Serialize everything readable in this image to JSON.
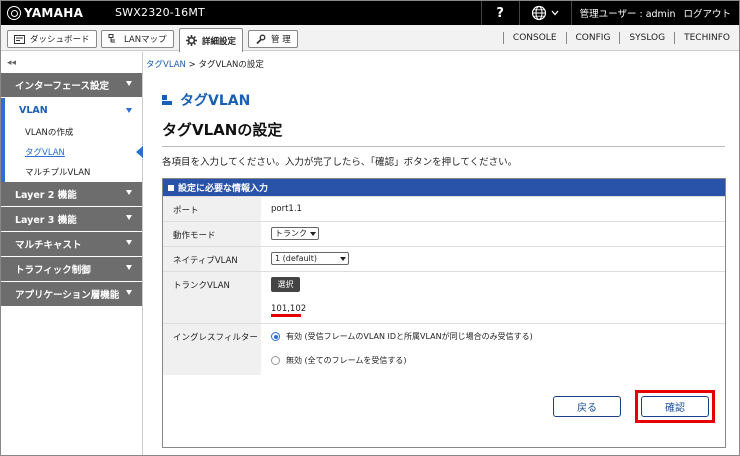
{
  "header": {
    "brand": "YAMAHA",
    "model": "SWX2320-16MT",
    "help": "?",
    "user_label": "管理ユーザー : admin",
    "logout": "ログアウト"
  },
  "nav": {
    "dashboard": "ダッシュボード",
    "lanmap": "LANマップ",
    "detail": "詳細設定",
    "manage": "管 理",
    "links": [
      "CONSOLE",
      "CONFIG",
      "SYSLOG",
      "TECHINFO"
    ]
  },
  "sidebar": {
    "collapse": "◂◂",
    "categories_top": [
      {
        "label": "インターフェース設定"
      }
    ],
    "open_category": "VLAN",
    "subitems": [
      {
        "label": "VLANの作成"
      },
      {
        "label": "タグVLAN"
      },
      {
        "label": "マルチプルVLAN"
      }
    ],
    "categories_bottom": [
      {
        "label": "Layer 2 機能"
      },
      {
        "label": "Layer 3 機能"
      },
      {
        "label": "マルチキャスト"
      },
      {
        "label": "トラフィック制御"
      },
      {
        "label": "アプリケーション層機能"
      }
    ]
  },
  "breadcrumb": {
    "link": "タグVLAN",
    "sep": " > ",
    "current": "タグVLANの設定"
  },
  "main": {
    "section_title": "タグVLAN",
    "page_title": "タグVLANの設定",
    "instruction": "各項目を入力してください。入力が完了したら、「確認」ボタンを押してください。"
  },
  "panel": {
    "title": "設定に必要な情報入力",
    "rows": {
      "port": {
        "label": "ポート",
        "value": "port1.1"
      },
      "mode": {
        "label": "動作モード",
        "value": "トランク"
      },
      "native": {
        "label": "ネイティブVLAN",
        "value": "1 (default)"
      },
      "trunk": {
        "label": "トランクVLAN",
        "button": "選択",
        "value": "101,102"
      },
      "ingress": {
        "label": "イングレスフィルター",
        "option_on": "有効 (受信フレームのVLAN IDと所属VLANが同じ場合のみ受信する)",
        "option_off": "無効 (全てのフレームを受信する)",
        "selected": "on"
      }
    },
    "back_button": "戻る",
    "confirm_button": "確認"
  },
  "colors": {
    "accent": "#2a6fd1",
    "panel_header": "#2953a8",
    "highlight": "#e60000"
  }
}
